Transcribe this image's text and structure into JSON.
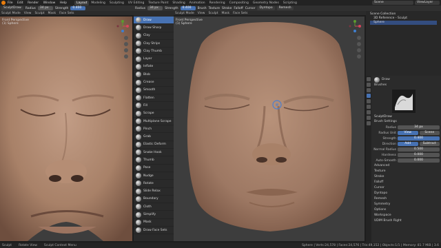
{
  "topbar": {
    "menus": [
      "File",
      "Edit",
      "Render",
      "Window",
      "Help"
    ],
    "workspaces": [
      "Layout",
      "Modeling",
      "Sculpting",
      "UV Editing",
      "Texture Paint",
      "Shading",
      "Animation",
      "Rendering",
      "Compositing",
      "Geometry Nodes",
      "Scripting"
    ],
    "active_workspace": "Layout",
    "scene": "Scene",
    "view_layer": "ViewLayer"
  },
  "left_view": {
    "mode": "Sculpt Mode",
    "menus": [
      "View",
      "Sculpt",
      "Mask",
      "Face Sets"
    ],
    "brush": "SculptDraw",
    "radius_label": "Radius",
    "radius_value": "34 px",
    "strength_label": "Strength",
    "strength_value": "0.400",
    "persp_title": "Front Perspective",
    "persp_object": "(1) Sphere"
  },
  "right_view": {
    "radius_label": "Radius",
    "radius_value": "34 px",
    "strength_label": "Strength",
    "strength_value": "0.400",
    "header_items": [
      "Brush",
      "Texture",
      "Stroke",
      "Falloff",
      "Cursor"
    ],
    "extra_buttons": [
      "Dyntopo",
      "Remesh"
    ],
    "mode": "Sculpt Mode",
    "menus": [
      "View",
      "Sculpt",
      "Mask",
      "Face Sets"
    ],
    "persp_title": "Front Perspective",
    "persp_object": "(1) Sphere"
  },
  "brush_panel": {
    "items": [
      "Draw",
      "Draw Sharp",
      "Clay",
      "Clay Strips",
      "Clay Thumb",
      "Layer",
      "Inflate",
      "Blob",
      "Crease",
      "Smooth",
      "Flatten",
      "Fill",
      "Scrape",
      "Multiplane Scrape",
      "Pinch",
      "Grab",
      "Elastic Deform",
      "Snake Hook",
      "Thumb",
      "Pose",
      "Nudge",
      "Rotate",
      "Slide Relax",
      "Boundary",
      "Cloth",
      "Simplify",
      "Mask",
      "Draw Face Sets"
    ],
    "active": "Draw"
  },
  "outliner": {
    "title": "Scene Collection",
    "items": [
      "3D Reference - Sculpt",
      "Sphere"
    ]
  },
  "properties": {
    "tool_name": "Draw",
    "brushes_label": "Brushes",
    "brush_name": "SculptDraw",
    "brush_settings_label": "Brush Settings",
    "rows": [
      {
        "label": "Radius",
        "value": "34 px"
      },
      {
        "label": "Radius Unit",
        "value": "View",
        "value2": "Scene"
      },
      {
        "label": "Strength",
        "value": "0.400"
      },
      {
        "label": "Direction",
        "value": "Add",
        "value2": "Subtract"
      },
      {
        "label": "Normal Radius",
        "value": "0.500"
      },
      {
        "label": "Hardness",
        "value": "0.000"
      },
      {
        "label": "Auto-Smooth",
        "value": "0.000"
      }
    ],
    "sections": [
      "Advanced",
      "Texture",
      "Stroke",
      "Falloff",
      "Cursor",
      "Dyntopo",
      "Remesh",
      "Symmetry",
      "Options",
      "Workspace"
    ],
    "footer": "UDIM Brush Right"
  },
  "statusbar": {
    "items": [
      "Sculpt",
      "Rotate View",
      "Sculpt Context Menu"
    ],
    "stats": "Sphere | Verts:24,578 | Faces:24,576 | Tris:49,152 | Objects:1/1 | Memory: 81.7 MiB | 3.6"
  },
  "colors": {
    "accent": "#4772b3",
    "skin_light": "#b8927a",
    "skin_dark": "#7d5a48",
    "viewport_bg": "#3d3d3d",
    "cursor_circle": "#4a7fd0"
  }
}
